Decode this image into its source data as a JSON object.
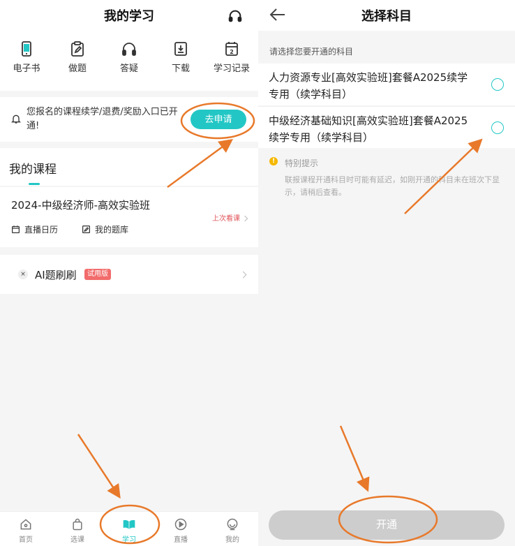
{
  "left": {
    "title": "我的学习",
    "quick_items": [
      {
        "label": "电子书",
        "icon": "ebook-icon"
      },
      {
        "label": "做题",
        "icon": "clipboard-pen-icon"
      },
      {
        "label": "答疑",
        "icon": "headphones-icon"
      },
      {
        "label": "下载",
        "icon": "download-tray-icon"
      },
      {
        "label": "学习记录",
        "icon": "calendar-icon"
      }
    ],
    "notice": {
      "text": "您报名的课程续学/退费/奖励入口已开通!",
      "button": "去申请"
    },
    "my_courses_title": "我的课程",
    "course": {
      "name": "2024-中级经济师-高效实验班",
      "last_viewed": "上次看课",
      "live_calendar": "直播日历",
      "question_bank": "我的题库"
    },
    "ai": {
      "label": "AI题刷刷",
      "badge": "试用版"
    },
    "bottom_nav": [
      {
        "label": "首页",
        "icon": "home-icon",
        "active": false
      },
      {
        "label": "选课",
        "icon": "shopping-bag-icon",
        "active": false
      },
      {
        "label": "学习",
        "icon": "open-book-icon",
        "active": true
      },
      {
        "label": "直播",
        "icon": "play-circle-icon",
        "active": false
      },
      {
        "label": "我的",
        "icon": "smiley-icon",
        "active": false
      }
    ]
  },
  "right": {
    "title": "选择科目",
    "prompt": "请选择您要开通的科目",
    "options": [
      "人力资源专业[高效实验班]套餐A2025续学专用（续学科目）",
      "中级经济基础知识[高效实验班]套餐A2025续学专用（续学科目）"
    ],
    "tip": {
      "title": "特别提示",
      "body": "联报课程开通科目时可能有延迟，如刚开通的科目未在班次下显示，请稍后查看。"
    },
    "open_button": "开通"
  },
  "colors": {
    "accent": "#22c7c5",
    "annotation": "#e8792a",
    "badge": "#f26b6b",
    "warning": "#f5b800"
  }
}
